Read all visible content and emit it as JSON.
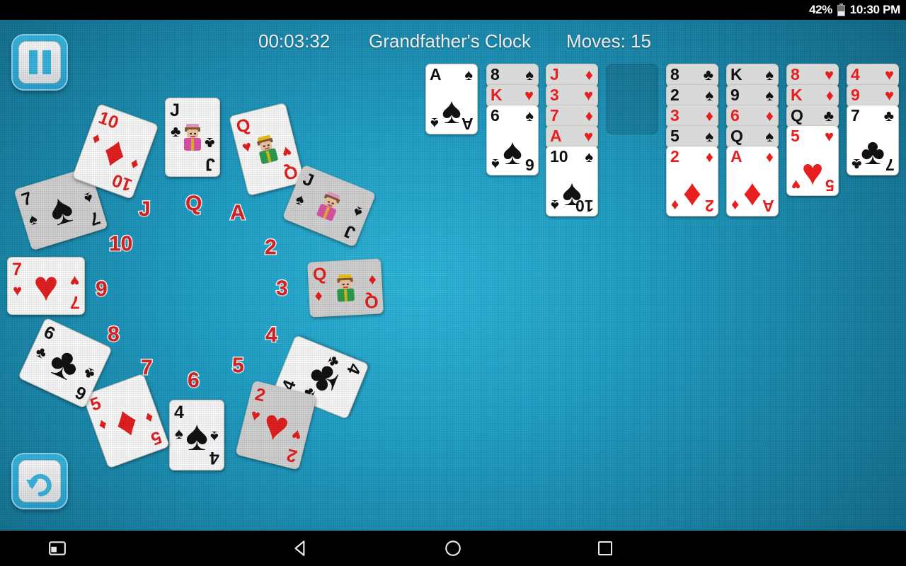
{
  "status_bar": {
    "battery_percent": "42%",
    "battery_icon": "battery-icon",
    "time": "10:30 PM"
  },
  "header": {
    "timer": "00:03:32",
    "title": "Grandfather's Clock",
    "moves": "Moves: 15"
  },
  "controls": {
    "pause_button": "pause-button",
    "undo_button": "undo-button"
  },
  "clock_positions": [
    "A",
    "2",
    "3",
    "4",
    "5",
    "6",
    "7",
    "8",
    "9",
    "10",
    "J",
    "Q"
  ],
  "clock_ring": [
    {
      "pos": "J",
      "rank": "J",
      "suit": "♣",
      "color": "blk",
      "face": true,
      "grey": false
    },
    {
      "pos": "Q",
      "rank": "Q",
      "suit": "♥",
      "color": "red",
      "face": true,
      "grey": false
    },
    {
      "pos": "A",
      "rank": "J",
      "suit": "♠",
      "color": "blk",
      "face": true,
      "grey": true
    },
    {
      "pos": "2",
      "rank": "Q",
      "suit": "♦",
      "color": "red",
      "face": true,
      "grey": true
    },
    {
      "pos": "3",
      "rank": "4",
      "suit": "♣",
      "color": "blk",
      "face": false,
      "grey": false
    },
    {
      "pos": "4",
      "rank": "2",
      "suit": "♥",
      "color": "red",
      "face": false,
      "grey": true
    },
    {
      "pos": "5",
      "rank": "4",
      "suit": "♠",
      "color": "blk",
      "face": false,
      "grey": false
    },
    {
      "pos": "6",
      "rank": "5",
      "suit": "♦",
      "color": "red",
      "face": false,
      "grey": false
    },
    {
      "pos": "7",
      "rank": "6",
      "suit": "♣",
      "color": "blk",
      "face": false,
      "grey": false
    },
    {
      "pos": "8",
      "rank": "7",
      "suit": "♥",
      "color": "red",
      "face": false,
      "grey": false
    },
    {
      "pos": "9",
      "rank": "7",
      "suit": "♠",
      "color": "blk",
      "face": false,
      "grey": true
    },
    {
      "pos": "10",
      "rank": "10",
      "suit": "♦",
      "color": "red",
      "face": false,
      "grey": false
    }
  ],
  "tableau": [
    {
      "index": 1,
      "cards": [
        {
          "rank": "A",
          "suit": "♠",
          "color": "blk",
          "faceup": true
        }
      ]
    },
    {
      "index": 2,
      "cards": [
        {
          "rank": "8",
          "suit": "♠",
          "color": "blk",
          "faceup": false
        },
        {
          "rank": "K",
          "suit": "♥",
          "color": "red",
          "faceup": false
        },
        {
          "rank": "6",
          "suit": "♠",
          "color": "blk",
          "faceup": true
        }
      ]
    },
    {
      "index": 3,
      "cards": [
        {
          "rank": "J",
          "suit": "♦",
          "color": "red",
          "faceup": false
        },
        {
          "rank": "3",
          "suit": "♥",
          "color": "red",
          "faceup": false
        },
        {
          "rank": "7",
          "suit": "♦",
          "color": "red",
          "faceup": false
        },
        {
          "rank": "A",
          "suit": "♥",
          "color": "red",
          "faceup": false
        },
        {
          "rank": "10",
          "suit": "♠",
          "color": "blk",
          "faceup": true
        }
      ]
    },
    {
      "index": 4,
      "cards": []
    },
    {
      "index": 5,
      "cards": [
        {
          "rank": "8",
          "suit": "♣",
          "color": "blk",
          "faceup": false
        },
        {
          "rank": "2",
          "suit": "♠",
          "color": "blk",
          "faceup": false
        },
        {
          "rank": "3",
          "suit": "♦",
          "color": "red",
          "faceup": false
        },
        {
          "rank": "5",
          "suit": "♠",
          "color": "blk",
          "faceup": false
        },
        {
          "rank": "2",
          "suit": "♦",
          "color": "red",
          "faceup": true
        }
      ]
    },
    {
      "index": 6,
      "cards": [
        {
          "rank": "K",
          "suit": "♠",
          "color": "blk",
          "faceup": false
        },
        {
          "rank": "9",
          "suit": "♠",
          "color": "blk",
          "faceup": false
        },
        {
          "rank": "6",
          "suit": "♦",
          "color": "red",
          "faceup": false
        },
        {
          "rank": "Q",
          "suit": "♠",
          "color": "blk",
          "faceup": false
        },
        {
          "rank": "A",
          "suit": "♦",
          "color": "red",
          "faceup": true
        }
      ]
    },
    {
      "index": 7,
      "cards": [
        {
          "rank": "8",
          "suit": "♥",
          "color": "red",
          "faceup": false
        },
        {
          "rank": "K",
          "suit": "♦",
          "color": "red",
          "faceup": false
        },
        {
          "rank": "Q",
          "suit": "♣",
          "color": "blk",
          "faceup": false
        },
        {
          "rank": "5",
          "suit": "♥",
          "color": "red",
          "faceup": true
        }
      ]
    },
    {
      "index": 8,
      "cards": [
        {
          "rank": "4",
          "suit": "♥",
          "color": "red",
          "faceup": false
        },
        {
          "rank": "9",
          "suit": "♥",
          "color": "red",
          "faceup": false
        },
        {
          "rank": "7",
          "suit": "♣",
          "color": "blk",
          "faceup": true
        }
      ]
    }
  ],
  "nav_bar": {
    "recent_icon": "recent-apps-icon",
    "back_icon": "back-triangle-icon",
    "home_icon": "home-circle-icon",
    "square_icon": "overview-square-icon"
  },
  "colors": {
    "felt": "#21a3cb",
    "accent": "#3bb6e0",
    "card_red": "#e81f1f",
    "card_black": "#111111",
    "facedown": "#d6d6d6"
  }
}
